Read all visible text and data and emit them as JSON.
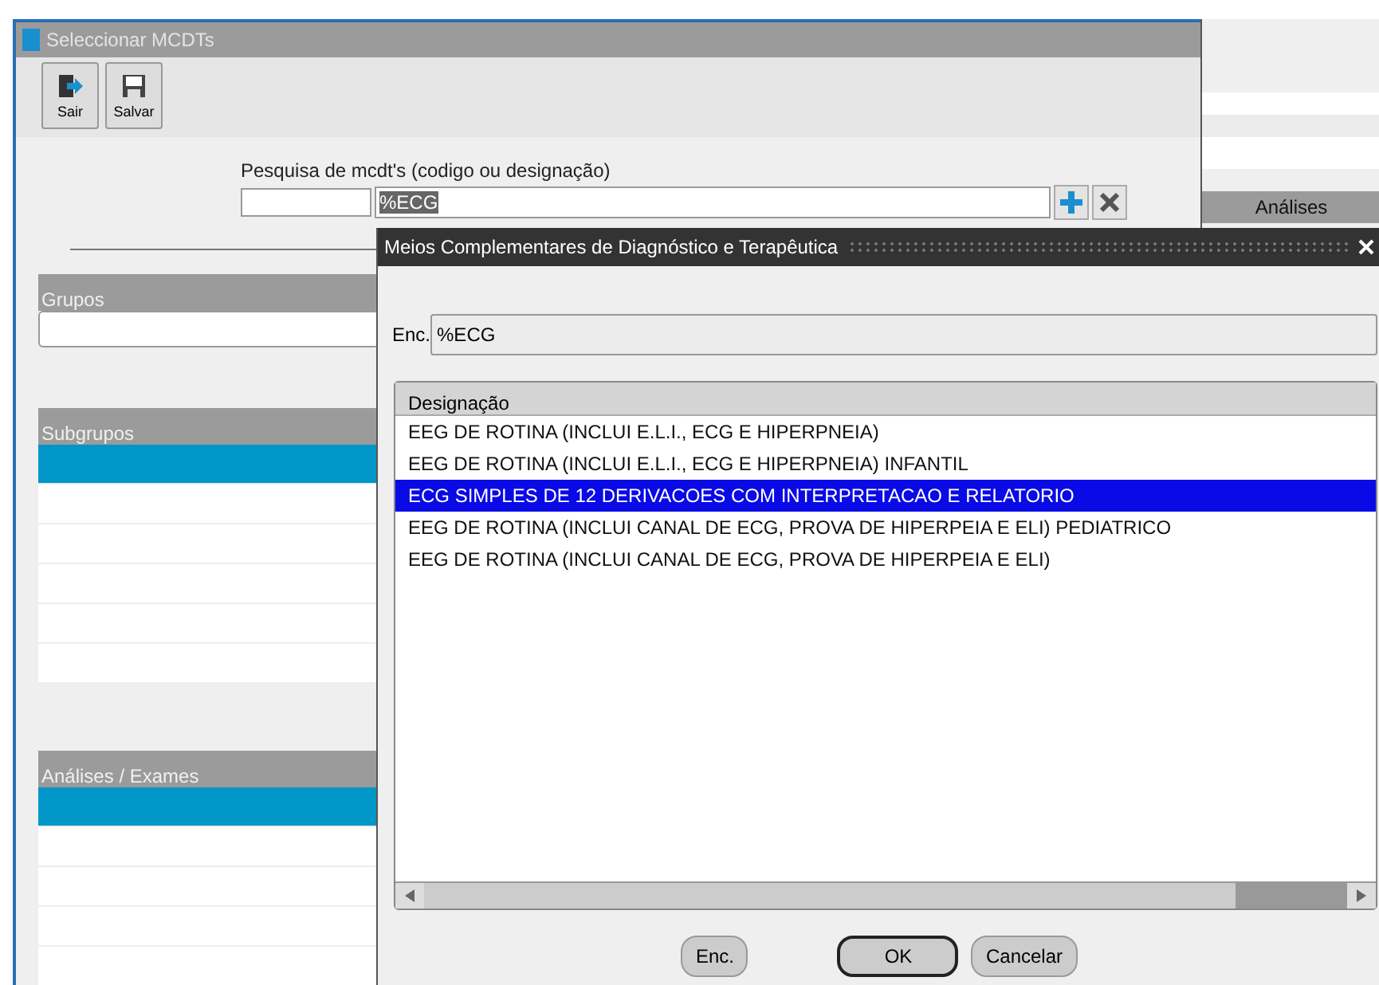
{
  "window": {
    "title": "Seleccionar MCDTs"
  },
  "toolbar": [
    {
      "label": "Sair",
      "kind": "exit"
    },
    {
      "label": "Salvar",
      "kind": "save"
    }
  ],
  "search": {
    "label": "Pesquisa de mcdt's (codigo ou designação)",
    "value": "%ECG"
  },
  "right_panel": {
    "header": "Análises"
  },
  "groups": {
    "header": "Grupos"
  },
  "subgroups": {
    "header": "Subgrupos",
    "rows": [
      {
        "selected": true
      },
      {
        "selected": false
      },
      {
        "selected": false
      },
      {
        "selected": false
      },
      {
        "selected": false
      },
      {
        "selected": false
      }
    ]
  },
  "exams": {
    "header": "Análises / Exames",
    "rows": [
      {
        "selected": true
      },
      {
        "selected": false
      },
      {
        "selected": false
      },
      {
        "selected": false
      },
      {
        "selected": false
      }
    ]
  },
  "dialog": {
    "title": "Meios Complementares de Diagnóstico e Terapêutica",
    "find_label": "Enc.",
    "find_value": "%ECG",
    "column": "Designação",
    "items": [
      {
        "text": "EEG DE ROTINA (INCLUI E.L.I., ECG E HIPERPNEIA)",
        "selected": false
      },
      {
        "text": "EEG DE ROTINA (INCLUI E.L.I., ECG E HIPERPNEIA) INFANTIL",
        "selected": false
      },
      {
        "text": "ECG SIMPLES DE 12 DERIVACOES COM INTERPRETACAO E RELATORIO",
        "selected": true
      },
      {
        "text": "EEG DE ROTINA (INCLUI CANAL DE ECG, PROVA DE HIPERPEIA E ELI) PEDIATRICO",
        "selected": false
      },
      {
        "text": "EEG DE ROTINA (INCLUI CANAL DE ECG, PROVA DE HIPERPEIA E ELI)",
        "selected": false
      }
    ],
    "buttons": [
      {
        "label": "Enc.",
        "kind": "plain"
      },
      {
        "label": "OK",
        "kind": "default"
      },
      {
        "label": "Cancelar",
        "kind": "plain"
      }
    ]
  }
}
